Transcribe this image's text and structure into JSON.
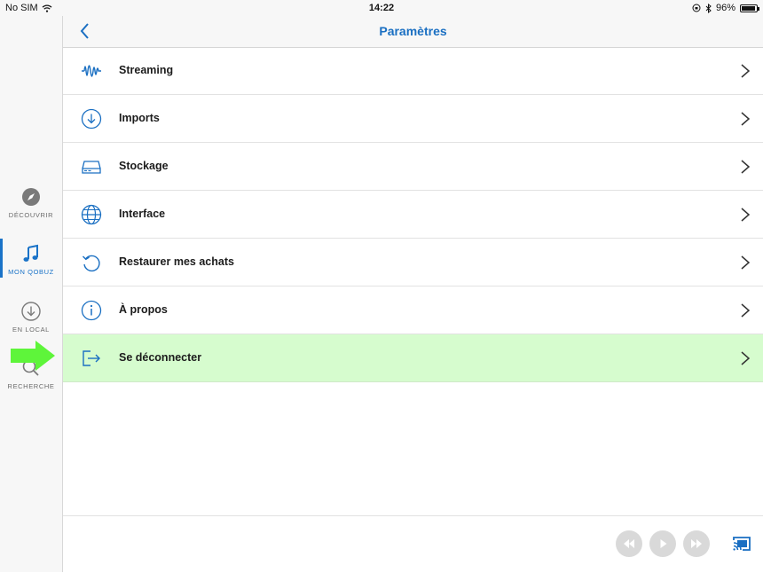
{
  "status_bar": {
    "carrier": "No SIM",
    "time": "14:22",
    "battery": "96%"
  },
  "sidebar": {
    "items": [
      {
        "label": "DÉCOUVRIR",
        "icon": "compass-icon",
        "active": false
      },
      {
        "label": "MON QOBUZ",
        "icon": "music-note-icon",
        "active": true
      },
      {
        "label": "EN LOCAL",
        "icon": "download-circle-icon",
        "active": false
      },
      {
        "label": "RECHERCHE",
        "icon": "search-icon",
        "active": false
      }
    ]
  },
  "navbar": {
    "title": "Paramètres",
    "back_icon": "chevron-left-icon"
  },
  "settings": {
    "items": [
      {
        "label": "Streaming",
        "icon": "waveform-icon"
      },
      {
        "label": "Imports",
        "icon": "download-circle-icon"
      },
      {
        "label": "Stockage",
        "icon": "hard-drive-icon"
      },
      {
        "label": "Interface",
        "icon": "globe-icon"
      },
      {
        "label": "Restaurer mes achats",
        "icon": "restore-icon"
      },
      {
        "label": "À propos",
        "icon": "info-icon"
      },
      {
        "label": "Se déconnecter",
        "icon": "logout-icon",
        "highlighted": true
      }
    ]
  },
  "player": {
    "controls": [
      "rewind-icon",
      "play-icon",
      "fast-forward-icon"
    ],
    "cast_icon": "cast-icon"
  },
  "colors": {
    "accent": "#1a6fc2",
    "highlight": "#d6fcce",
    "annotation_arrow": "#5ef53a"
  }
}
